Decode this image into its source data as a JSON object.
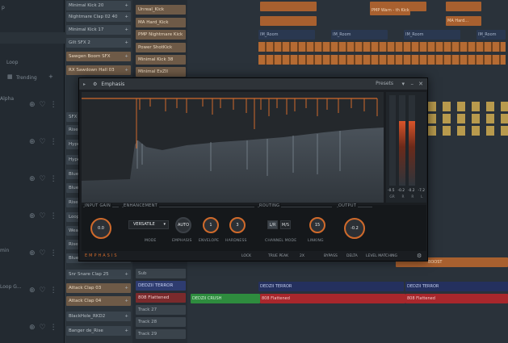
{
  "browser": {
    "partial_top": "p",
    "loop_label": "Loop",
    "trending_label": "Trending",
    "items": [
      {
        "name": "Alpha"
      },
      {
        "name": ""
      },
      {
        "name": ""
      },
      {
        "name": ""
      },
      {
        "name": "min"
      },
      {
        "name": "Loop G..."
      }
    ]
  },
  "rack": {
    "channels": [
      "Minimal Kick 20",
      "Nightmare Clap 02 40",
      "Minimal Kick 17",
      "Gilt SFX 2",
      "Sawgen Boom SFX",
      "RX Sawdown Hall 03",
      "",
      "SFX",
      "Rise",
      "Rise",
      "Hype",
      "Hype",
      "Blue",
      "Blue",
      "Loop",
      "Wear",
      "Rise",
      "Blue",
      "Blue",
      "Snr Snare Clap 25",
      "Attack Clap 03",
      "Attack Clap 04",
      "BlackHole_RKD2",
      "Banger de_Rise"
    ]
  },
  "playlist": {
    "tracks_top": [
      "Unreal_Kick",
      "MA Hard_Kick",
      "PMP Nightmare Kick",
      "Power ShotKick",
      "Minimal Kick 38",
      "Minimal ExZII"
    ],
    "tracks_bottom": [
      "Sub",
      "DEDZII TERROR",
      "808 Flattened",
      "Track 27",
      "Track 28",
      "Track 29"
    ],
    "clips": {
      "clip_top1": "PMP Warn - th Kick",
      "clip_top2": "MA Hard..."
    },
    "row_clip_labels": {
      "dedzii_terror": "DEDZII TERROR",
      "flattened": "808 Flattened",
      "dedzii_crush": "DEDZII CRUSH"
    },
    "room_label": "IM_Room",
    "boost_label": "BOOST"
  },
  "plugin": {
    "title": "Emphasis",
    "presets_label": "Presets",
    "window_buttons": [
      "▾",
      "–",
      "✕"
    ],
    "input_gain": {
      "label": "INPUT GAIN",
      "value": "0.0"
    },
    "enhancement": {
      "label": "ENHANCEMENT",
      "mode_value": "VERSATILE",
      "mode_label": "MODE",
      "emphasis_value": "AUTO",
      "emphasis_label": "EMPHASIS",
      "envelope_value": "1",
      "envelope_label": "ENVELOPE",
      "hardness_value": "3",
      "hardness_label": "HARDNESS"
    },
    "routing": {
      "label": "ROUTING",
      "lr": "L/R",
      "ms": "M/S",
      "channel_mode_label": "CHANNEL MODE",
      "linking_value": "15",
      "linking_label": "LINKING"
    },
    "output": {
      "label": "OUTPUT",
      "value": "-0.2"
    },
    "meters": {
      "values": [
        "-0.5",
        "-0.2",
        "-0.2",
        "-7.2"
      ],
      "labels": [
        "GR",
        "R",
        "R",
        "L"
      ]
    },
    "footer": {
      "brand": "EMPHASIS",
      "lock": "LOCK",
      "true_peak": "TRUE PEAK",
      "oversample": "2X",
      "bypass": "BYPASS",
      "delta": "DELTA",
      "level_matching": "LEVEL MATCHING"
    },
    "accent_color": "#d06a2b"
  }
}
